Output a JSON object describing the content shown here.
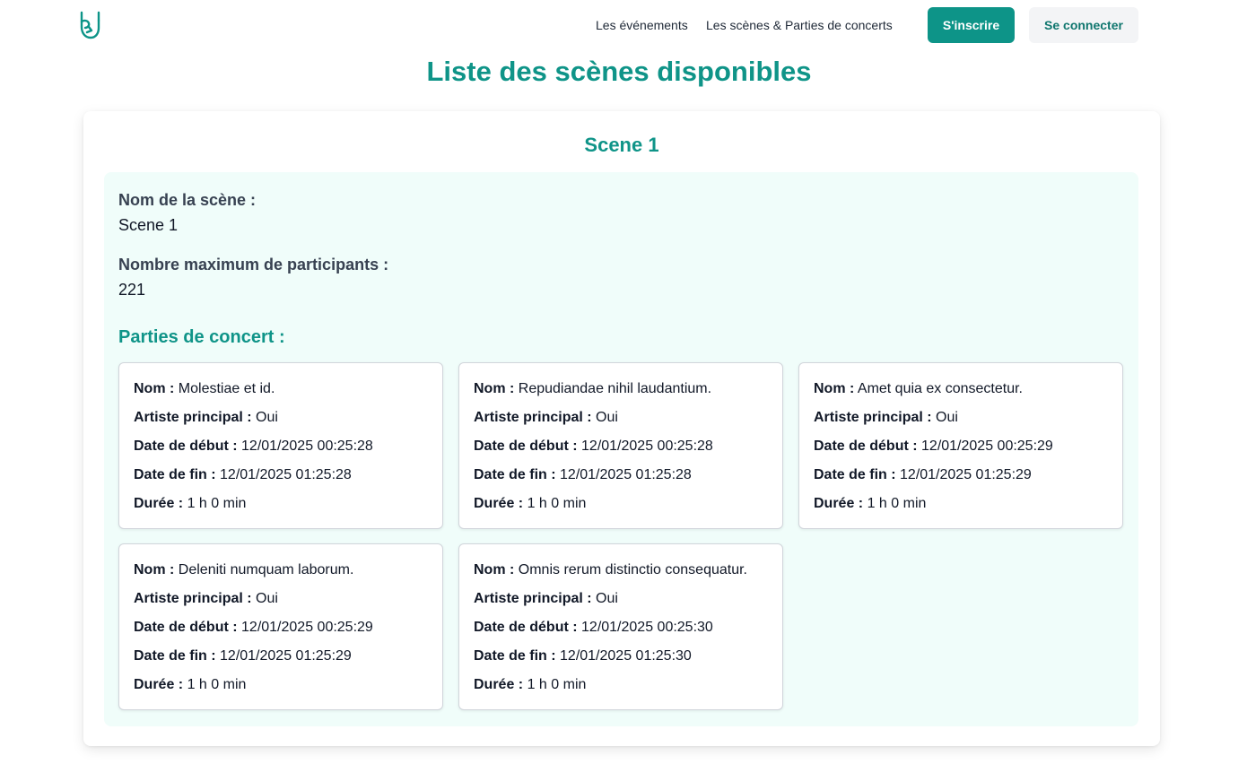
{
  "header": {
    "logo_icon": "rock-hand-icon",
    "nav": [
      {
        "label": "Les événements"
      },
      {
        "label": "Les scènes & Parties de concerts"
      }
    ],
    "signup_label": "S'inscrire",
    "login_label": "Se connecter"
  },
  "page_title": "Liste des scènes disponibles",
  "scene": {
    "title": "Scene 1",
    "name_label": "Nom de la scène :",
    "name_value": "Scene 1",
    "max_label": "Nombre maximum de participants :",
    "max_value": "221",
    "parts_heading": "Parties de concert :",
    "labels": {
      "nom": "Nom :",
      "artiste": "Artiste principal :",
      "debut": "Date de début :",
      "fin": "Date de fin :",
      "duree": "Durée :"
    },
    "parts": [
      {
        "nom": "Molestiae et id.",
        "artiste": "Oui",
        "debut": "12/01/2025 00:25:28",
        "fin": "12/01/2025 01:25:28",
        "duree": "1 h 0 min"
      },
      {
        "nom": "Repudiandae nihil laudantium.",
        "artiste": "Oui",
        "debut": "12/01/2025 00:25:28",
        "fin": "12/01/2025 01:25:28",
        "duree": "1 h 0 min"
      },
      {
        "nom": "Amet quia ex consectetur.",
        "artiste": "Oui",
        "debut": "12/01/2025 00:25:29",
        "fin": "12/01/2025 01:25:29",
        "duree": "1 h 0 min"
      },
      {
        "nom": "Deleniti numquam laborum.",
        "artiste": "Oui",
        "debut": "12/01/2025 00:25:29",
        "fin": "12/01/2025 01:25:29",
        "duree": "1 h 0 min"
      },
      {
        "nom": "Omnis rerum distinctio consequatur.",
        "artiste": "Oui",
        "debut": "12/01/2025 00:25:30",
        "fin": "12/01/2025 01:25:30",
        "duree": "1 h 0 min"
      }
    ]
  },
  "colors": {
    "accent": "#0d9488",
    "scene_body_bg": "#f0fdfa",
    "login_bg": "#f3f4f6"
  }
}
